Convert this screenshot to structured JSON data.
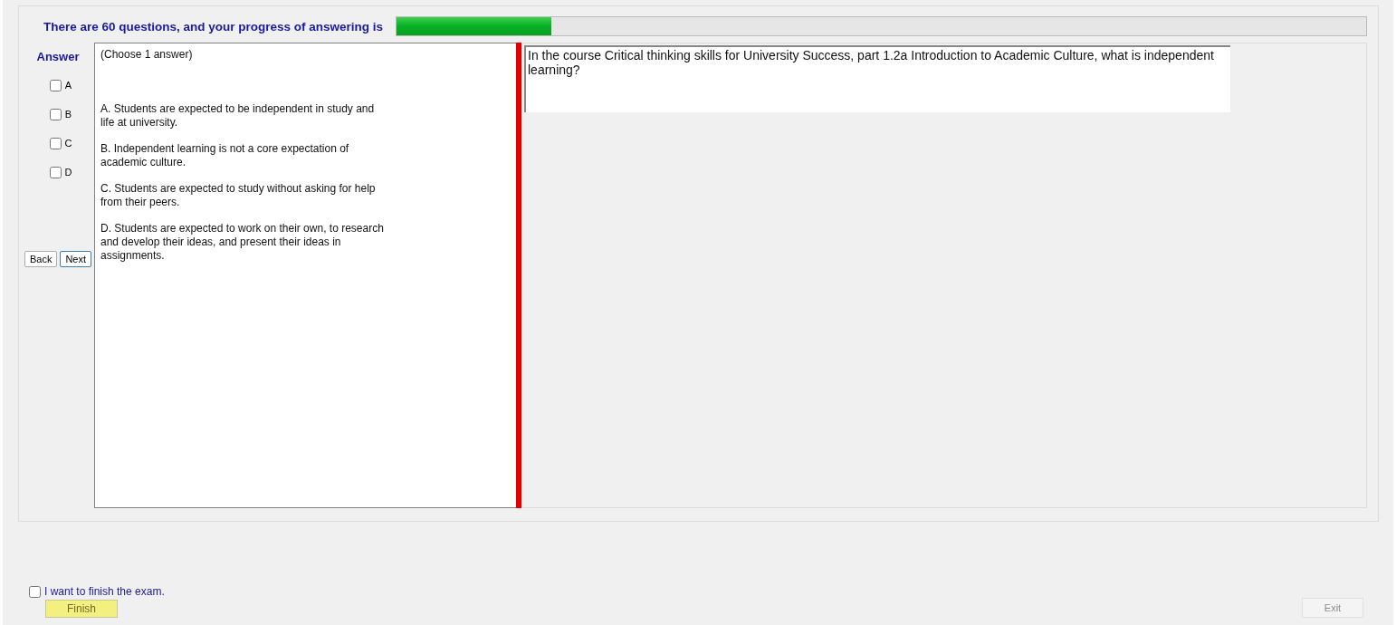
{
  "header": {
    "progress_text": "There are 60 questions, and your progress of answering is",
    "progress": {
      "level": 0.16
    }
  },
  "answer_panel": {
    "title": "Answer",
    "options": [
      {
        "label": "A",
        "checked": false
      },
      {
        "label": "B",
        "checked": false
      },
      {
        "label": "C",
        "checked": false
      },
      {
        "label": "D",
        "checked": false
      }
    ],
    "buttons": [
      "Back",
      "Next"
    ]
  },
  "choices": {
    "instruction": "(Choose 1 answer)",
    "items": [
      "A.  Students are expected to be independent in study and life at university.",
      "B.  Independent learning is not a core expectation of academic culture.",
      "C.  Students are expected to study without asking for help from their peers.",
      "D.  Students are expected to work on their own, to research and develop their ideas, and present their ideas in assignments."
    ]
  },
  "question": "In the course Critical thinking skills for University Success, part 1.2a Introduction to Academic Culture, what is independent learning?",
  "footer": {
    "finish_check": {
      "label": "I want to finish the exam.",
      "checked": false
    },
    "finish_button": {
      "label": "Finish",
      "disabled": true
    },
    "exit_button": {
      "label": "Exit",
      "disabled": true
    }
  }
}
